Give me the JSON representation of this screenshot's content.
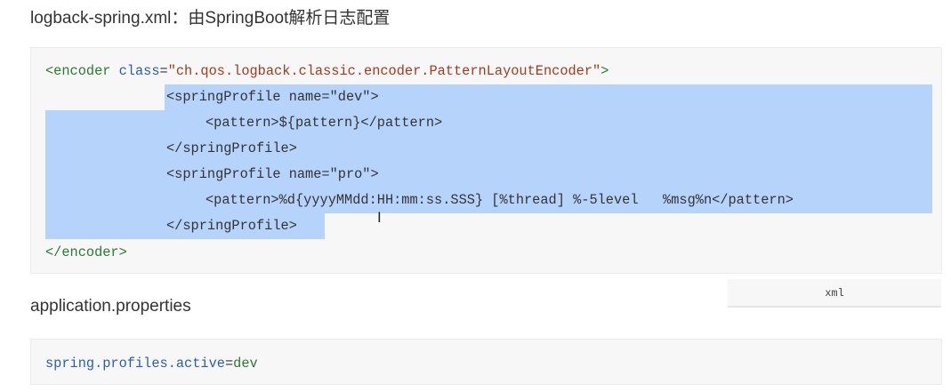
{
  "headings": {
    "logback_title": "logback-spring.xml：由SpringBoot解析日志配置",
    "properties_title": "application.properties"
  },
  "code_block_1": {
    "language": "xml",
    "lines": {
      "l1": {
        "open": "<encoder",
        "attr": " class",
        "eq": "=",
        "value": "\"ch.qos.logback.classic.encoder.PatternLayoutEncoder\"",
        "close": ">"
      },
      "l2": {
        "text": "<springProfile name=\"dev\">"
      },
      "l3": {
        "text": "<pattern>${pattern}</pattern>"
      },
      "l4": {
        "text": "</springProfile>"
      },
      "l5": {
        "text": "<springProfile name=\"pro\">"
      },
      "l6": {
        "text": "<pattern>%d{yyyyMMdd:HH:mm:ss.SSS} [%thread] %-5level   %msg%n</pattern>"
      },
      "l7": {
        "text": "</springProfile>"
      },
      "l8": {
        "text": "</encoder>"
      }
    }
  },
  "code_block_2": {
    "key": "spring.profiles.active",
    "eq": "=",
    "value": "dev"
  },
  "colors": {
    "selection": "#b6d3fb",
    "code_background": "#f7f7f7",
    "tag": "#2b7a32",
    "attribute": "#2b5fad",
    "string": "#a33a1e"
  },
  "icons": {
    "text_cursor": "i-beam-cursor-icon"
  }
}
